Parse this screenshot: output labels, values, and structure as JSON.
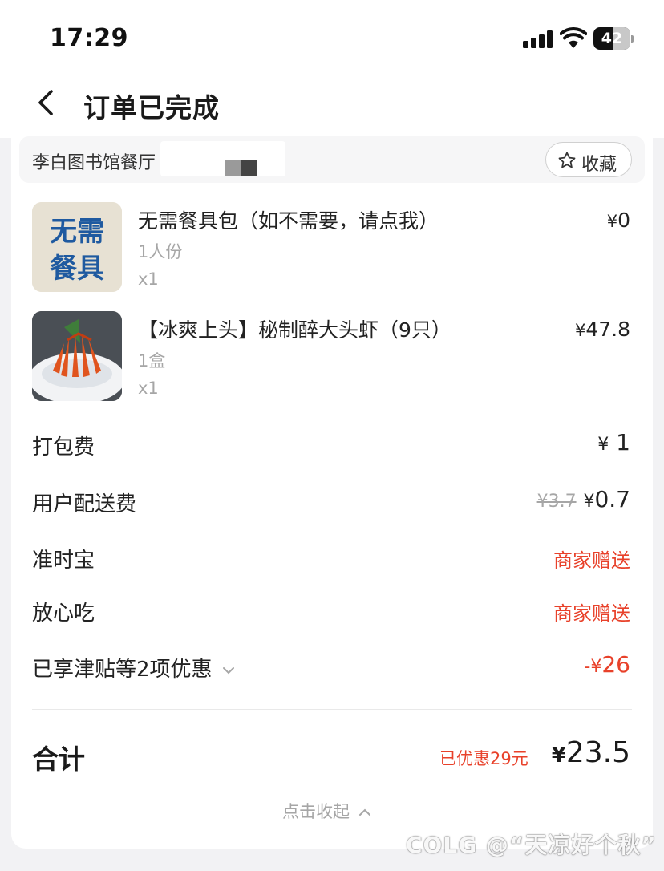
{
  "status_bar": {
    "time": "17:29",
    "battery": "42"
  },
  "header": {
    "title": "订单已完成"
  },
  "shop": {
    "name": "李白图书馆餐厅",
    "favorite_label": "收藏"
  },
  "items": [
    {
      "name": "无需餐具包（如不需要，请点我）",
      "spec": "1人份",
      "qty": "x1",
      "price_symbol": "¥",
      "price": "0",
      "image_text": [
        "无需",
        "餐具"
      ]
    },
    {
      "name": "【冰爽上头】秘制醉大头虾（9只）",
      "spec": "1盒",
      "qty": "x1",
      "price_symbol": "¥",
      "price": "47.8"
    }
  ],
  "fees": {
    "packing": {
      "label": "打包费",
      "symbol": "¥",
      "value": "1"
    },
    "delivery": {
      "label": "用户配送费",
      "original": "¥3.7",
      "symbol": "¥",
      "value": "0.7"
    },
    "ontime": {
      "label": "准时宝",
      "value": "商家赠送"
    },
    "safe": {
      "label": "放心吃",
      "value": "商家赠送"
    },
    "discount": {
      "label": "已享津贴等2项优惠",
      "prefix": "-¥",
      "value": "26"
    }
  },
  "total": {
    "label": "合计",
    "saved": "已优惠29元",
    "symbol": "¥",
    "value": "23.5"
  },
  "collapse_label": "点击收起",
  "watermark": "COLG @“天凉好个秋”",
  "colors": {
    "accent_red": "#e8412a",
    "muted": "#a6a6a6"
  }
}
